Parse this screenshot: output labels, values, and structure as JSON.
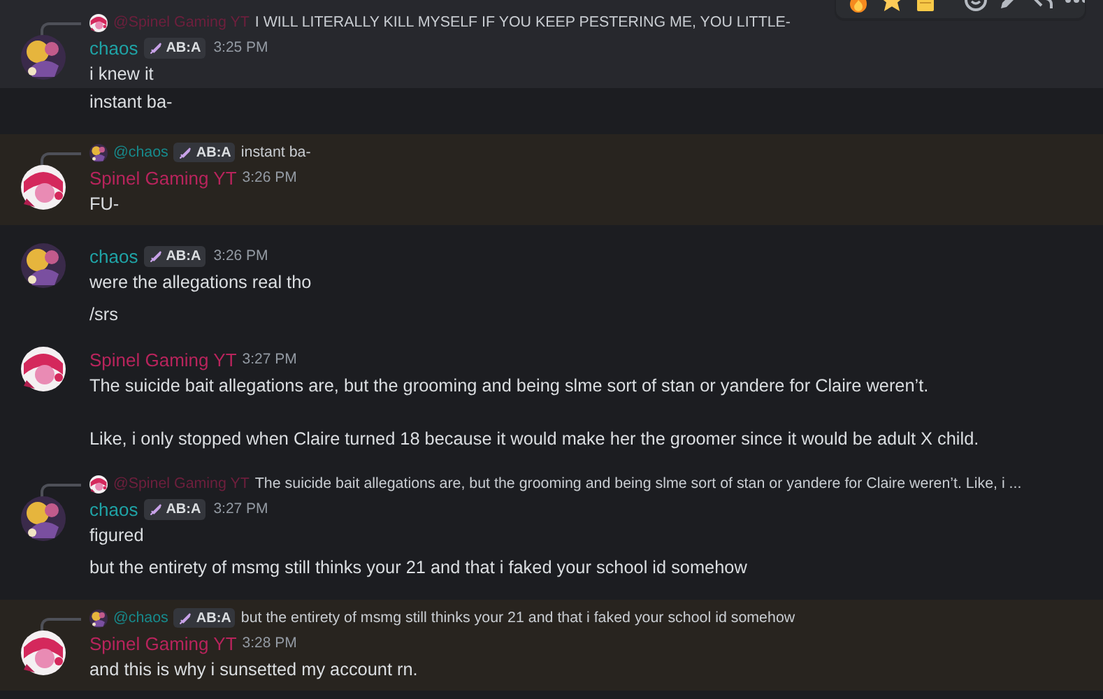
{
  "message_toolbar": true,
  "messages": [
    {
      "kind": "full",
      "hovered": true,
      "mentions_you": false,
      "author": {
        "name": "chaos",
        "color": "#1fa3a6",
        "badge": "AB:A"
      },
      "time": "3:25 PM",
      "reply": {
        "author": "@Spinel Gaming YT",
        "color": "#6e1f3d",
        "text": "I WILL LITERALLY KILL MYSELF IF YOU KEEP PESTERING ME, YOU LITTLE-"
      },
      "lines": [
        "i knew it"
      ]
    },
    {
      "kind": "continuation",
      "hovered": false,
      "mentions_you": false,
      "lines": [
        "instant ba-"
      ]
    },
    {
      "kind": "full",
      "hovered": false,
      "mentions_you": true,
      "author": {
        "name": "Spinel Gaming YT",
        "color": "#b8245c"
      },
      "time": "3:26 PM",
      "reply": {
        "author": "@chaos",
        "color": "#178a8c",
        "badge": "AB:A",
        "text": "instant ba-"
      },
      "lines": [
        "FU-"
      ]
    },
    {
      "kind": "full",
      "hovered": false,
      "mentions_you": false,
      "author": {
        "name": "chaos",
        "color": "#1fa3a6",
        "badge": "AB:A"
      },
      "time": "3:26 PM",
      "lines": [
        "were the allegations real tho",
        "/srs"
      ]
    },
    {
      "kind": "full",
      "hovered": false,
      "mentions_you": false,
      "author": {
        "name": "Spinel Gaming YT",
        "color": "#b8245c"
      },
      "time": "3:27 PM",
      "lines": [
        "The suicide bait allegations are, but the grooming and being slme sort of stan or yandere for Claire weren’t.\n\nLike, i only stopped when Claire turned 18 because it would make her the groomer since it would be adult X child."
      ]
    },
    {
      "kind": "full",
      "hovered": false,
      "mentions_you": false,
      "author": {
        "name": "chaos",
        "color": "#1fa3a6",
        "badge": "AB:A"
      },
      "time": "3:27 PM",
      "reply": {
        "author": "@Spinel Gaming YT",
        "color": "#6e1f3d",
        "text": "The suicide bait allegations are, but the grooming and being slme sort of stan or yandere for Claire weren’t.  Like, i ..."
      },
      "lines": [
        "figured",
        "but the entirety of msmg still thinks your 21 and that i faked your school id somehow"
      ]
    },
    {
      "kind": "full",
      "hovered": false,
      "mentions_you": true,
      "author": {
        "name": "Spinel Gaming YT",
        "color": "#b8245c"
      },
      "time": "3:28 PM",
      "reply": {
        "author": "@chaos",
        "color": "#178a8c",
        "badge": "AB:A",
        "text": "but the entirety of msmg still thinks your 21 and that i faked your school id somehow"
      },
      "lines": [
        "and this is why i sunsetted my account rn."
      ]
    }
  ]
}
